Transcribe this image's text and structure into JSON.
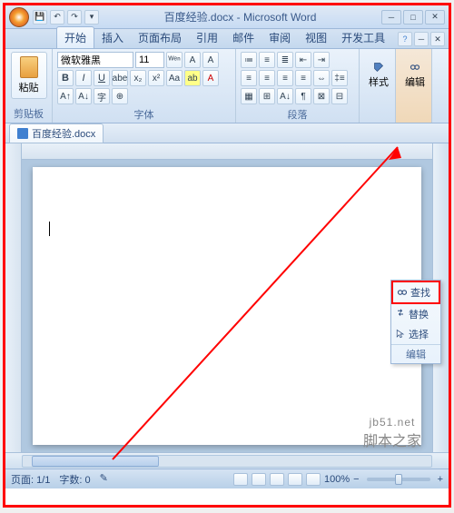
{
  "title": "百度经验.docx - Microsoft Word",
  "tabs": {
    "home": "开始",
    "insert": "插入",
    "layout": "页面布局",
    "refs": "引用",
    "mail": "邮件",
    "review": "审阅",
    "view": "视图",
    "dev": "开发工具"
  },
  "ribbon": {
    "clipboard": {
      "paste": "粘贴",
      "label": "剪贴板"
    },
    "font": {
      "name": "微软雅黑",
      "size": "11",
      "label": "字体"
    },
    "paragraph": {
      "label": "段落"
    },
    "styles": {
      "label": "样式"
    },
    "editing": {
      "label": "编辑"
    }
  },
  "doc_tab": "百度经验.docx",
  "edit_menu": {
    "find": "查找",
    "replace": "替换",
    "select": "选择",
    "label": "编辑"
  },
  "status": {
    "page": "页面: 1/1",
    "words": "字数: 0",
    "zoom": "100%"
  },
  "watermark": {
    "site": "jb51.net",
    "name": "脚本之家"
  }
}
